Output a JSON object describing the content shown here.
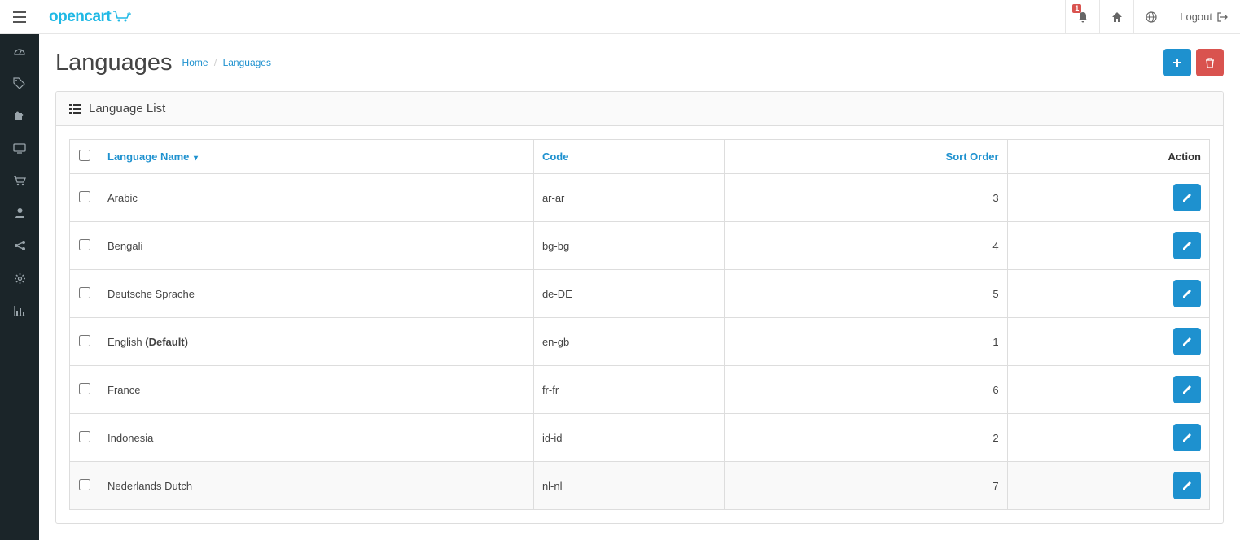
{
  "brand": {
    "name": "opencart"
  },
  "header": {
    "notification_count": "1",
    "logout_label": "Logout"
  },
  "page": {
    "title": "Languages",
    "breadcrumbs": {
      "home": "Home",
      "current": "Languages"
    }
  },
  "panel": {
    "title": "Language List"
  },
  "table": {
    "headers": {
      "name": "Language Name",
      "code": "Code",
      "sort_order": "Sort Order",
      "action": "Action"
    },
    "rows": [
      {
        "name": "Arabic",
        "default": false,
        "code": "ar-ar",
        "sort_order": "3",
        "alt": false
      },
      {
        "name": "Bengali",
        "default": false,
        "code": "bg-bg",
        "sort_order": "4",
        "alt": false
      },
      {
        "name": "Deutsche Sprache",
        "default": false,
        "code": "de-DE",
        "sort_order": "5",
        "alt": false
      },
      {
        "name": "English",
        "default": true,
        "default_label": "(Default)",
        "code": "en-gb",
        "sort_order": "1",
        "alt": false
      },
      {
        "name": "France",
        "default": false,
        "code": "fr-fr",
        "sort_order": "6",
        "alt": false
      },
      {
        "name": "Indonesia",
        "default": false,
        "code": "id-id",
        "sort_order": "2",
        "alt": false
      },
      {
        "name": "Nederlands Dutch",
        "default": false,
        "code": "nl-nl",
        "sort_order": "7",
        "alt": true
      }
    ]
  },
  "colors": {
    "primary": "#1e91cf",
    "danger": "#d9534f",
    "brand": "#20b9e5"
  }
}
